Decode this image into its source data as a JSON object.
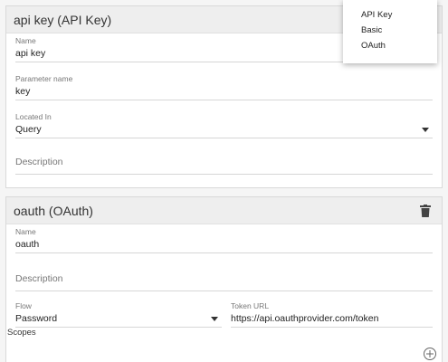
{
  "apikey_card": {
    "title": "api key (API Key)",
    "name_label": "Name",
    "name_value": "api key",
    "param_label": "Parameter name",
    "param_value": "key",
    "located_label": "Located In",
    "located_value": "Query",
    "description_placeholder": "Description"
  },
  "type_menu": {
    "items": [
      "API Key",
      "Basic",
      "OAuth"
    ]
  },
  "oauth_card": {
    "title": "oauth (OAuth)",
    "name_label": "Name",
    "name_value": "oauth",
    "description_placeholder": "Description",
    "flow_label": "Flow",
    "flow_value": "Password",
    "token_label": "Token URL",
    "token_value": "https://api.oauthprovider.com/token",
    "scopes_label": "Scopes"
  }
}
